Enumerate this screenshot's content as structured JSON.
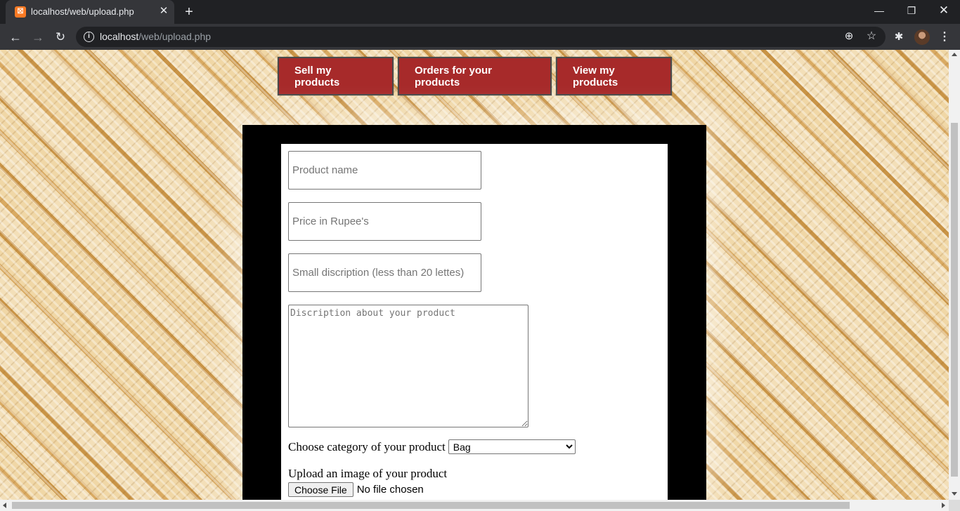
{
  "browser": {
    "tab_title": "localhost/web/upload.php",
    "tab_favicon": "xampp-icon",
    "url_host": "localhost",
    "url_path": "/web/upload.php"
  },
  "page": {
    "nav_buttons": {
      "sell": "Sell my products",
      "orders": "Orders for your products",
      "view": "View my products"
    },
    "form": {
      "product_name_placeholder": "Product name",
      "price_placeholder": "Price in Rupee's",
      "small_desc_placeholder": "Small discription (less than 20 lettes)",
      "description_placeholder": "Discription about your product",
      "category_label": "Choose category of your product",
      "category_selected": "Bag",
      "upload_label": "Upload an image of your product",
      "file_button": "Choose File",
      "file_status": "No file chosen"
    }
  },
  "colors": {
    "button_bg": "#a72a2a",
    "frame_bg": "#000000",
    "panel_bg": "#ffffff"
  }
}
